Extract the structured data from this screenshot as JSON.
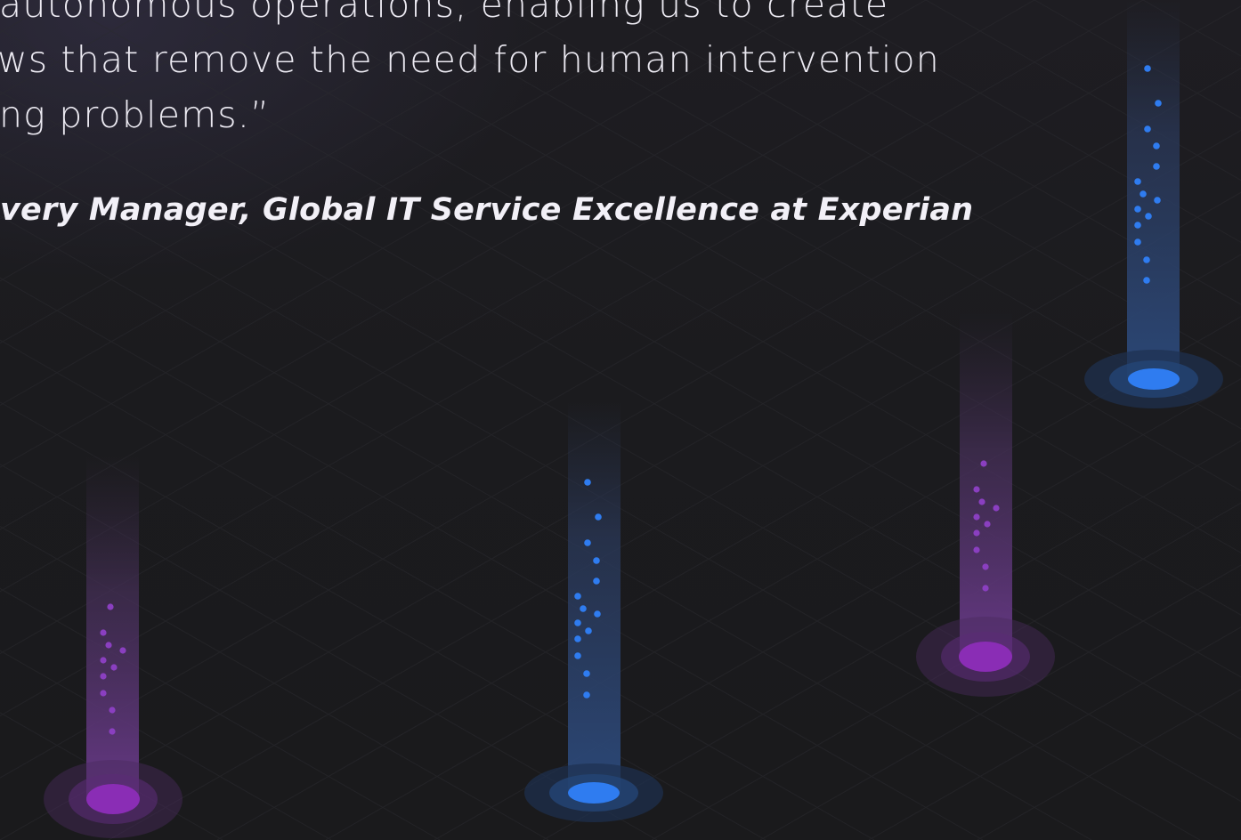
{
  "testimonial": {
    "quote_lines": [
      "autonomous operations, enabling us to create",
      "ws that remove the need for human intervention",
      "ng problems.”"
    ],
    "attribution": "very Manager, Global IT Service Excellence at Experian"
  },
  "colors": {
    "background": "#1b1b1e",
    "quote_text": "#eceaf2",
    "blue_accent": "#2f7cf0",
    "purple_accent": "#9a2fbf"
  }
}
